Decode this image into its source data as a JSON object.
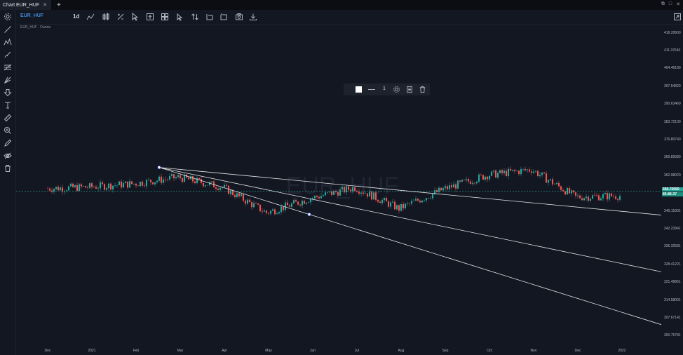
{
  "window": {
    "tab_title": "Chart EUR_HUF",
    "tab_close": "✕",
    "new_tab": "+",
    "controls": [
      "⧉",
      "□",
      "✕"
    ]
  },
  "toolbar": {
    "symbol": "EUR_HUF",
    "interval": "1d"
  },
  "legend": "EUR_HUF · Oanda",
  "float_toolbar": {
    "line_width": "1"
  },
  "y_axis_labels": [
    "418.28900",
    "411.37540",
    "404.46180",
    "397.54820",
    "390.63460",
    "383.72100",
    "376.80740",
    "369.89380",
    "362.98020",
    "349.15301",
    "342.23941",
    "335.32581",
    "328.41221",
    "321.49861",
    "314.58001",
    "307.67141",
    "300.75781"
  ],
  "price_tag": {
    "top": "356.75950",
    "bottom": "85:86:37"
  },
  "x_axis_labels": [
    "Dec",
    "2021",
    "Feb",
    "Mar",
    "Apr",
    "May",
    "Jun",
    "Jul",
    "Aug",
    "Sep",
    "Oct",
    "Nov",
    "Dec",
    "2022"
  ],
  "colors": {
    "up": "#26a69a",
    "down": "#ef5350",
    "background": "#131722",
    "accent": "#3d8ad7",
    "drawing": "#e6e6e6"
  },
  "chart_data": {
    "type": "candlestick",
    "symbol": "EUR_HUF",
    "ylim": [
      297.3,
      421.7
    ],
    "anchor_price": 366.0,
    "trend_lines_end_prices": [
      347.5,
      325.5,
      305.0
    ],
    "months": [
      {
        "label": "Dec",
        "close": 357.8
      },
      {
        "label": "2021",
        "close": 358.4
      },
      {
        "label": "Feb",
        "close": 359.7
      },
      {
        "label": "Mar",
        "close": 362.2
      },
      {
        "label": "Apr",
        "close": 358.4
      },
      {
        "label": "May",
        "close": 348.4
      },
      {
        "label": "Jun",
        "close": 354.0
      },
      {
        "label": "Jul",
        "close": 358.2
      },
      {
        "label": "Aug",
        "close": 350.0
      },
      {
        "label": "Sep",
        "close": 357.5
      },
      {
        "label": "Oct",
        "close": 363.0
      },
      {
        "label": "Nov",
        "close": 365.2
      },
      {
        "label": "Dec",
        "close": 354.5
      },
      {
        "label": "2022",
        "close": 355.0
      }
    ]
  }
}
